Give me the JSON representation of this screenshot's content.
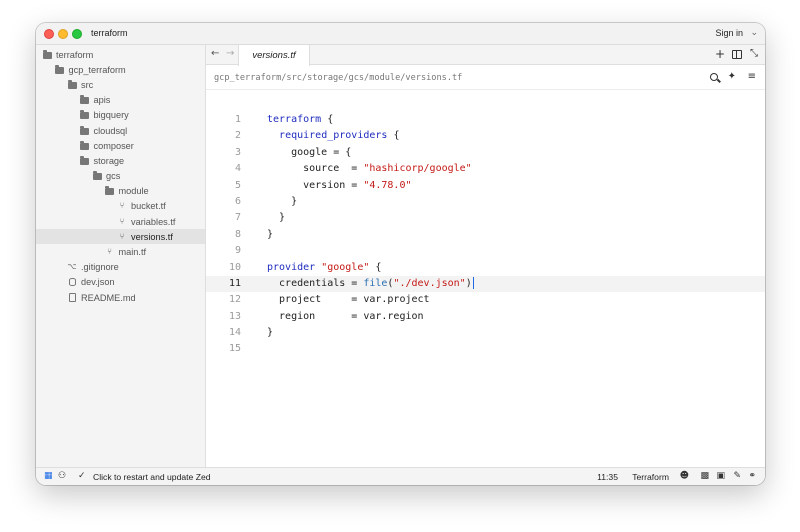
{
  "window": {
    "title": "terraform",
    "sign_in": "Sign in"
  },
  "sidebar": {
    "items": [
      {
        "label": "terraform",
        "kind": "folder",
        "depth": 0
      },
      {
        "label": "gcp_terraform",
        "kind": "folder",
        "depth": 1
      },
      {
        "label": "src",
        "kind": "folder",
        "depth": 2
      },
      {
        "label": "apis",
        "kind": "folder",
        "depth": 3
      },
      {
        "label": "bigquery",
        "kind": "folder",
        "depth": 3
      },
      {
        "label": "cloudsql",
        "kind": "folder",
        "depth": 3
      },
      {
        "label": "composer",
        "kind": "folder",
        "depth": 3
      },
      {
        "label": "storage",
        "kind": "folder",
        "depth": 3
      },
      {
        "label": "gcs",
        "kind": "folder",
        "depth": 4
      },
      {
        "label": "module",
        "kind": "folder",
        "depth": 5
      },
      {
        "label": "bucket.tf",
        "kind": "tf",
        "depth": 6
      },
      {
        "label": "variables.tf",
        "kind": "tf",
        "depth": 6
      },
      {
        "label": "versions.tf",
        "kind": "tf",
        "depth": 6,
        "selected": true
      },
      {
        "label": "main.tf",
        "kind": "tf",
        "depth": 5
      },
      {
        "label": ".gitignore",
        "kind": "git",
        "depth": 2
      },
      {
        "label": "dev.json",
        "kind": "db",
        "depth": 2
      },
      {
        "label": "README.md",
        "kind": "doc",
        "depth": 2
      }
    ]
  },
  "editor": {
    "tab_label": "versions.tf",
    "breadcrumb": "gcp_terraform/src/storage/gcs/module/versions.tf",
    "active_line": 11,
    "lines": [
      {
        "n": "1",
        "code": [
          {
            "t": "terraform",
            "c": "kw"
          },
          {
            "t": " {"
          }
        ]
      },
      {
        "n": "2",
        "code": [
          {
            "t": "  "
          },
          {
            "t": "required_providers",
            "c": "kw"
          },
          {
            "t": " {"
          }
        ]
      },
      {
        "n": "3",
        "code": [
          {
            "t": "    google = {"
          }
        ]
      },
      {
        "n": "4",
        "code": [
          {
            "t": "      source  = "
          },
          {
            "t": "\"hashicorp/google\"",
            "c": "str"
          }
        ]
      },
      {
        "n": "5",
        "code": [
          {
            "t": "      version = "
          },
          {
            "t": "\"4.78.0\"",
            "c": "str"
          }
        ]
      },
      {
        "n": "6",
        "code": [
          {
            "t": "    }"
          }
        ]
      },
      {
        "n": "7",
        "code": [
          {
            "t": "  }"
          }
        ]
      },
      {
        "n": "8",
        "code": [
          {
            "t": "}"
          }
        ]
      },
      {
        "n": "9",
        "code": []
      },
      {
        "n": "10",
        "code": [
          {
            "t": "provider",
            "c": "kw"
          },
          {
            "t": " "
          },
          {
            "t": "\"google\"",
            "c": "str"
          },
          {
            "t": " {"
          }
        ]
      },
      {
        "n": "11",
        "code": [
          {
            "t": "  credentials = "
          },
          {
            "t": "file",
            "c": "fn"
          },
          {
            "t": "("
          },
          {
            "t": "\"./dev.json\"",
            "c": "str"
          },
          {
            "t": ")"
          }
        ],
        "cursor": true
      },
      {
        "n": "12",
        "code": [
          {
            "t": "  project     = var.project"
          }
        ]
      },
      {
        "n": "13",
        "code": [
          {
            "t": "  region      = var.region"
          }
        ]
      },
      {
        "n": "14",
        "code": [
          {
            "t": "}"
          }
        ]
      },
      {
        "n": "15",
        "code": []
      }
    ]
  },
  "statusbar": {
    "message": "Click to restart and update Zed",
    "cursor_position": "11:35",
    "language": "Terraform"
  },
  "icons": {
    "back": "arrow-left-icon",
    "forward": "arrow-right-icon",
    "new_tab": "plus-icon",
    "split": "split-pane-icon",
    "expand": "expand-icon",
    "search": "search-icon",
    "assistant": "sparkle-icon",
    "settings": "sliders-icon"
  },
  "colors": {
    "keyword": "#1f2dbf",
    "string": "#c41a16",
    "function": "#2b6fb3",
    "cursor": "#1d6ae5",
    "selected_row": "#e3e3e3"
  }
}
